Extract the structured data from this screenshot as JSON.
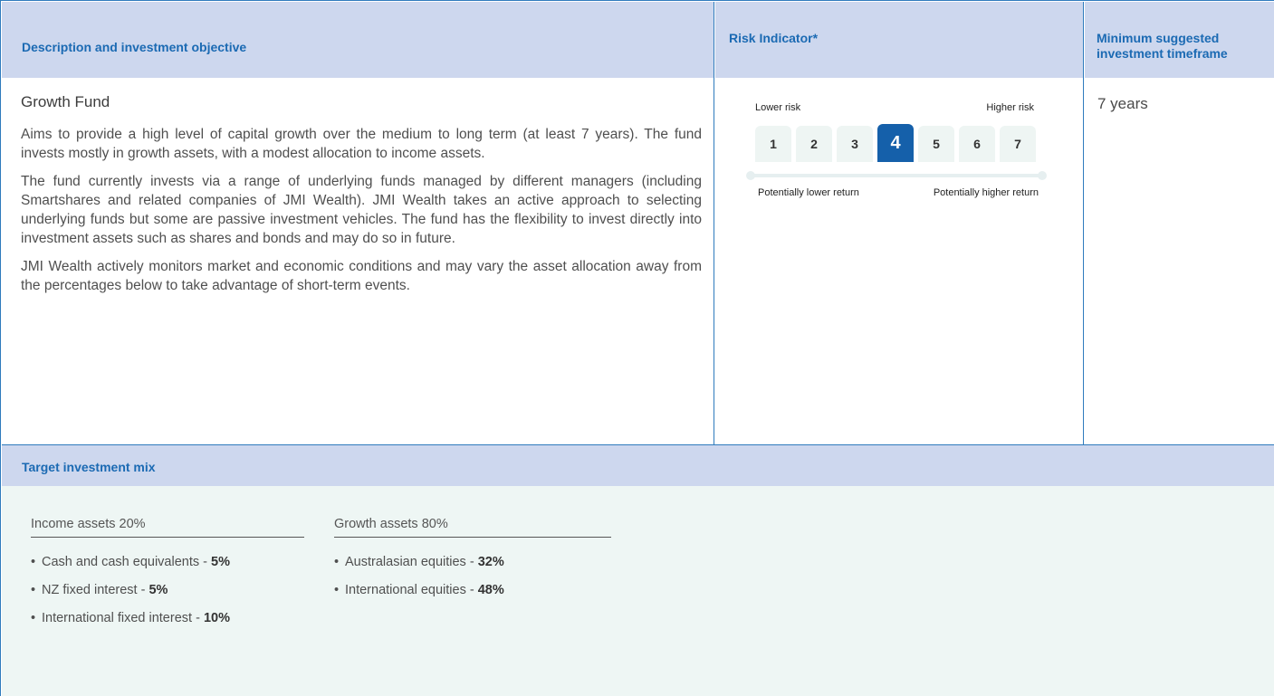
{
  "header": {
    "description": "Description and investment objective",
    "risk": "Risk Indicator*",
    "timeframe_line1": "Minimum suggested",
    "timeframe_line2": "investment timeframe"
  },
  "fund": {
    "title": "Growth Fund",
    "paragraphs": [
      "Aims to provide a high level of capital growth over the medium to long term (at least 7 years). The fund invests mostly in growth assets, with a modest allocation to income assets.",
      "The fund currently invests via a range of underlying funds managed by different managers (including Smartshares and related companies of JMI Wealth). JMI Wealth takes an active approach to selecting underlying funds but some are passive investment vehicles. The fund has the flexibility to invest directly into investment assets such as shares and bonds and may do so in future.",
      "JMI Wealth actively monitors market and economic conditions and may vary the asset allocation away from the percentages below to take advantage of short-term events."
    ]
  },
  "risk_indicator": {
    "lower_label": "Lower risk",
    "higher_label": "Higher risk",
    "levels": [
      "1",
      "2",
      "3",
      "4",
      "5",
      "6",
      "7"
    ],
    "selected_level": 4,
    "lower_return_label": "Potentially lower return",
    "higher_return_label": "Potentially higher return",
    "active_color": "#1560aa"
  },
  "timeframe": "7 years",
  "mix": {
    "title": "Target investment mix",
    "income": {
      "title": "Income assets 20%",
      "items": [
        {
          "label": "Cash and cash equivalents - ",
          "value": "5%"
        },
        {
          "label": "NZ fixed interest - ",
          "value": "5%"
        },
        {
          "label": "International fixed interest - ",
          "value": "10%"
        }
      ]
    },
    "growth": {
      "title": "Growth assets 80%",
      "items": [
        {
          "label": "Australasian equities - ",
          "value": "32%"
        },
        {
          "label": "International equities - ",
          "value": "48%"
        }
      ]
    }
  },
  "colors": {
    "header_bg": "#cdd7ee",
    "header_text": "#1b6ab3",
    "border": "#2f7bbd",
    "mix_bg": "#eef6f4"
  }
}
